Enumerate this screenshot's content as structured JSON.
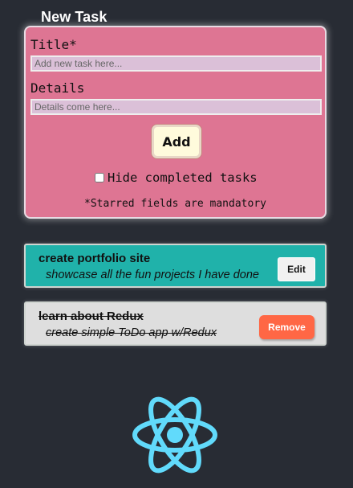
{
  "colors": {
    "background": "#282c34",
    "form_card": "#de7593",
    "active_task": "#20b2aa",
    "completed_task": "#dedede",
    "remove_button": "#ff6745",
    "react_logo": "#61dafb"
  },
  "header": {
    "title": "New Task"
  },
  "form": {
    "title_label": "Title*",
    "title_placeholder": "Add new task here...",
    "title_value": "",
    "details_label": "Details",
    "details_placeholder": "Details come here...",
    "details_value": "",
    "add_label": "Add",
    "hide_completed_label": "Hide completed tasks",
    "hide_completed_checked": false,
    "mandatory_note": "*Starred fields are mandatory"
  },
  "tasks": [
    {
      "title": "create portfolio site",
      "details": "showcase all the fun projects I have done",
      "completed": false,
      "action_label": "Edit"
    },
    {
      "title": "learn about Redux",
      "details": "create simple ToDo app w/Redux",
      "completed": true,
      "action_label": "Remove"
    }
  ],
  "footer": {
    "logo_icon": "react-logo-icon"
  }
}
